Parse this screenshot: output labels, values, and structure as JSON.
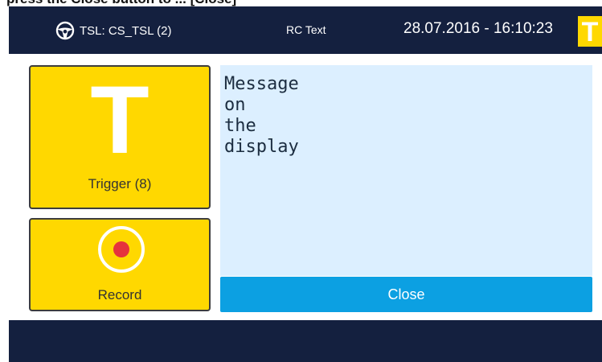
{
  "instruction_fragment": "press the Close button to ... [Close]",
  "header": {
    "tsl_label": "TSL: CS_TSL (2)",
    "center_label": "RC Text",
    "datetime": "28.07.2016 - 16:10:23",
    "badge_letter": "T",
    "steering_icon": "steering-wheel-icon",
    "background_color": "#14203f",
    "badge_color": "#ffd800"
  },
  "tiles": {
    "trigger": {
      "letter": "T",
      "label": "Trigger (8)"
    },
    "record": {
      "icon": "record-icon",
      "label": "Record"
    },
    "tile_color": "#ffd800",
    "record_dot_color": "#e5323d"
  },
  "message": {
    "lines": [
      "Message",
      "on",
      "the",
      "display"
    ],
    "background_color": "#dcefff"
  },
  "close_button": {
    "label": "Close",
    "color": "#0ca0e2"
  }
}
